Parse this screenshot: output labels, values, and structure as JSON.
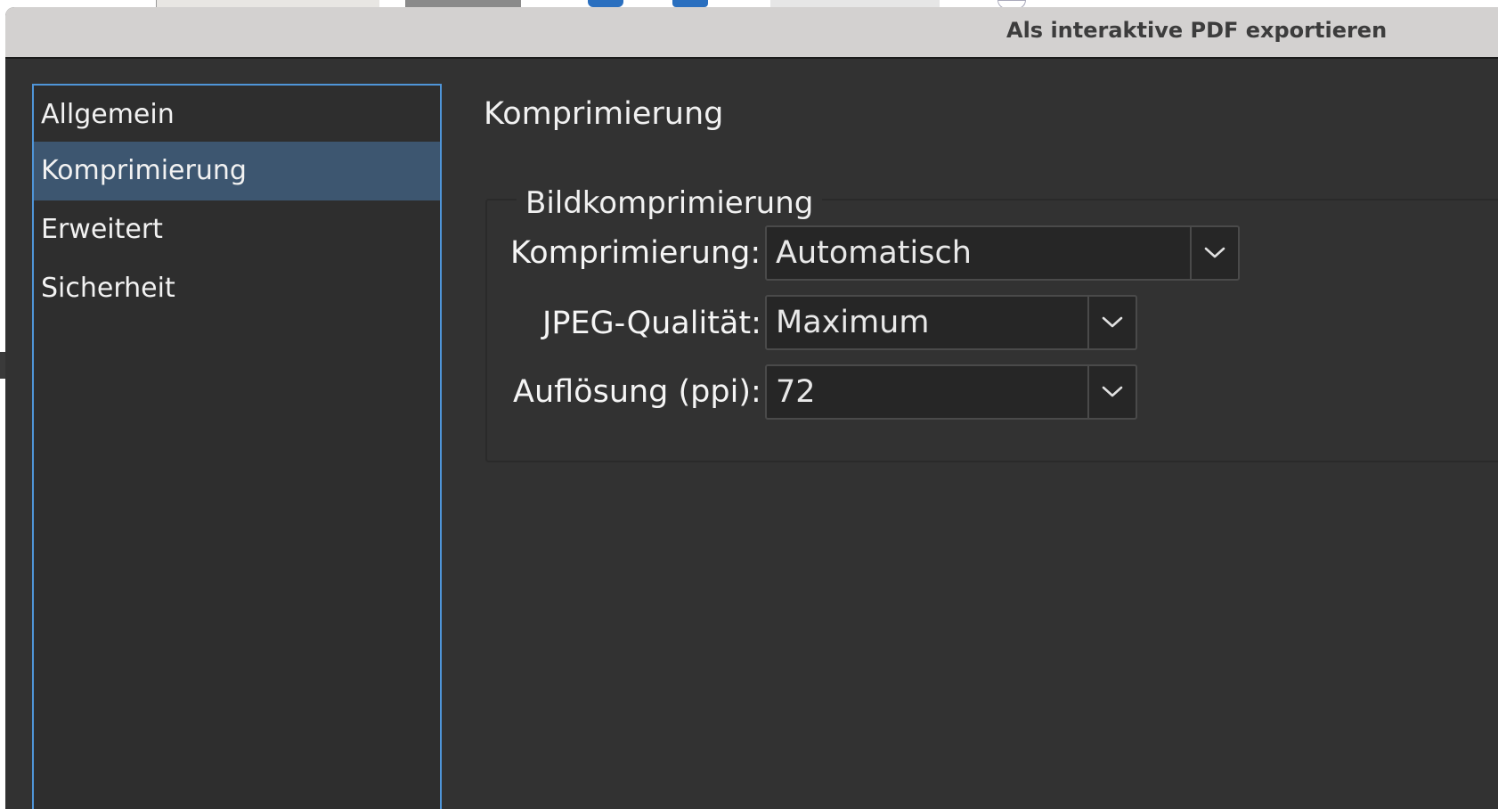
{
  "window": {
    "title": "Als interaktive PDF exportieren"
  },
  "sidebar": {
    "items": [
      {
        "label": "Allgemein",
        "selected": false
      },
      {
        "label": "Komprimierung",
        "selected": true
      },
      {
        "label": "Erweitert",
        "selected": false
      },
      {
        "label": "Sicherheit",
        "selected": false
      }
    ]
  },
  "main": {
    "section_title": "Komprimierung",
    "group": {
      "legend": "Bildkomprimierung",
      "compression": {
        "label": "Komprimierung:",
        "value": "Automatisch"
      },
      "jpeg_quality": {
        "label": "JPEG-Qualität:",
        "value": "Maximum"
      },
      "resolution": {
        "label": "Auflösung (ppi):",
        "value": "72"
      }
    }
  },
  "icons": {
    "dropdown": "chevron-down-icon"
  },
  "colors": {
    "accent_border": "#4f95d8",
    "selection": "#3d5670",
    "panel_bg": "#323232",
    "titlebar_bg": "#d3d1d0"
  }
}
